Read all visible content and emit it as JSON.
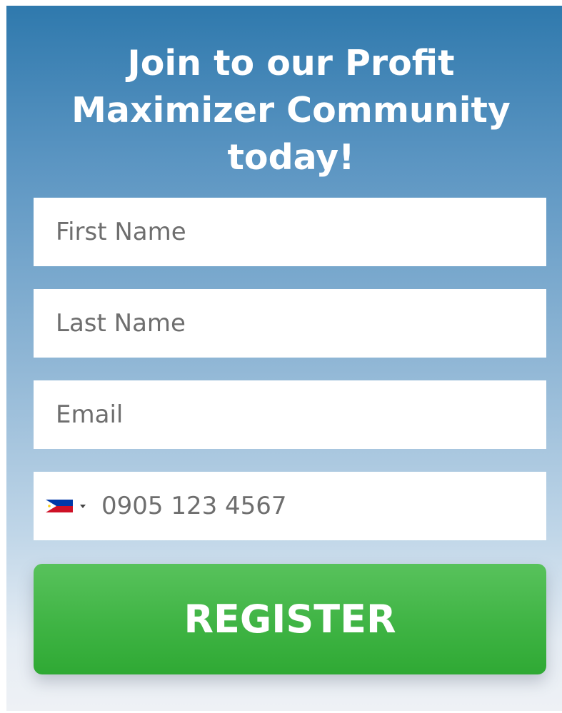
{
  "form": {
    "title_lines": [
      "Join to our Profit",
      "Maximizer Community",
      "today!"
    ],
    "first_name": {
      "placeholder": "First Name",
      "value": ""
    },
    "last_name": {
      "placeholder": "Last Name",
      "value": ""
    },
    "email": {
      "placeholder": "Email",
      "value": ""
    },
    "phone": {
      "placeholder": "0905 123 4567",
      "value": "",
      "country_flag": "philippines-flag-icon"
    },
    "submit_label": "REGISTER"
  },
  "colors": {
    "header_blue": "#2f79ad",
    "button_green": "#3fb444",
    "field_bg": "#ffffff"
  }
}
